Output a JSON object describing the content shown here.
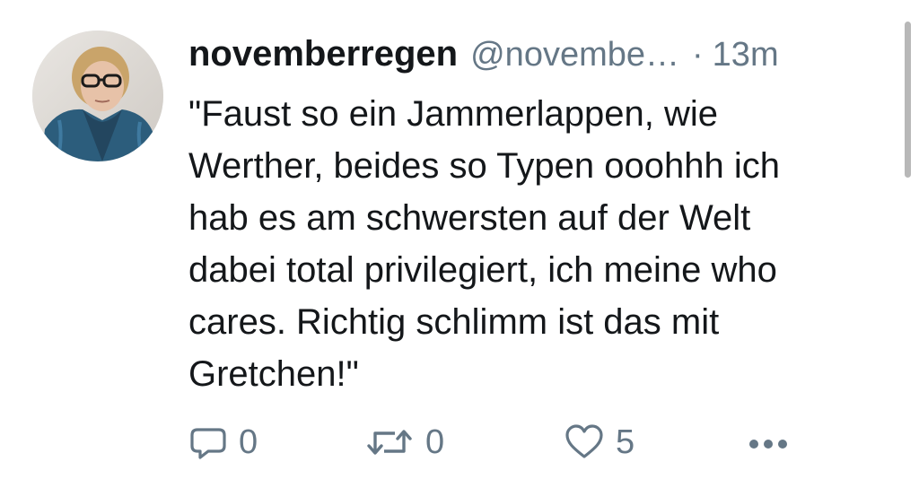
{
  "tweet": {
    "display_name": "novemberregen",
    "handle": "@novembe…",
    "separator": "·",
    "time": "13m",
    "body_lines": [
      "\"Faust so ein Jammerlappen, wie",
      "Werther, beides so Typen ooohhh ich",
      "hab es am schwersten auf der Welt",
      "dabei total privilegiert, ich meine who",
      "cares. Richtig schlimm ist das mit",
      "Gretchen!\""
    ]
  },
  "actions": {
    "reply": {
      "icon": "reply-icon",
      "count": "0"
    },
    "retweet": {
      "icon": "retweet-icon",
      "count": "0"
    },
    "like": {
      "icon": "heart-icon",
      "count": "5"
    },
    "more": {
      "icon": "more-icon"
    }
  },
  "colors": {
    "text": "#14171a",
    "secondary": "#657786",
    "background": "#ffffff"
  }
}
